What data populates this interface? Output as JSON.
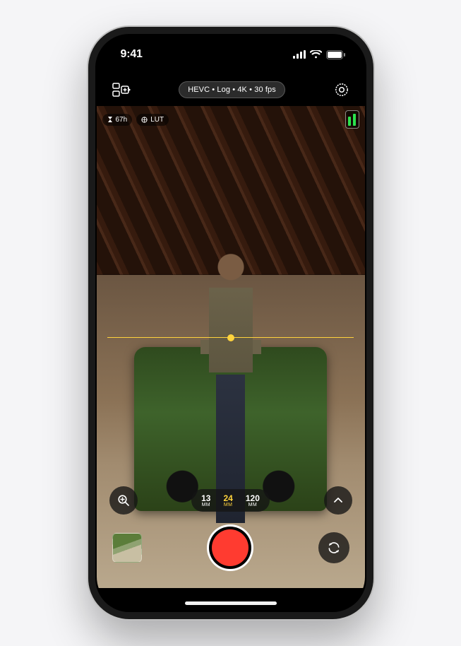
{
  "status": {
    "time": "9:41"
  },
  "header": {
    "format_text": "HEVC • Log • 4K • 30 fps"
  },
  "viewfinder": {
    "time_badge": "67h",
    "lut_badge": "LUT"
  },
  "lenses": {
    "items": [
      {
        "value": "13",
        "unit": "MM"
      },
      {
        "value": "24",
        "unit": "MM"
      },
      {
        "value": "120",
        "unit": "MM"
      }
    ],
    "active_index": 1
  },
  "colors": {
    "record": "#ff3b30",
    "accent_yellow": "#ffd33d",
    "audio_green": "#2be24d"
  }
}
